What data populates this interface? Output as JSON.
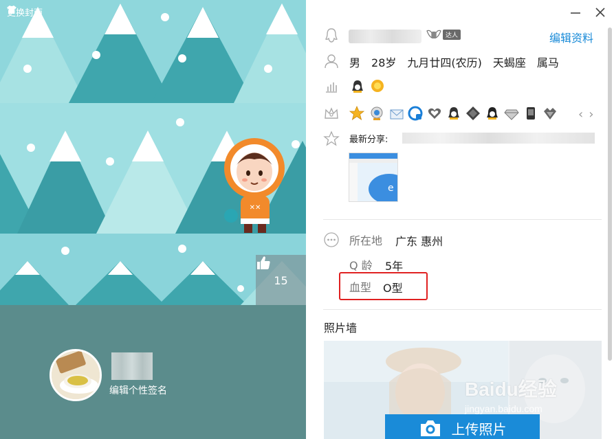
{
  "window": {
    "minimize_label": "minimize",
    "close_label": "close"
  },
  "cover": {
    "change_cover_label": "更换封面",
    "change_cover_icon": "tshirt-icon",
    "like_icon": "thumbs-up-icon",
    "like_count": "15"
  },
  "profile": {
    "signature_label": "编辑个性签名",
    "avatar_desc": "tea-cup-avatar"
  },
  "header": {
    "penguin_icon": "qq-penguin-icon",
    "daren_tag": "达人",
    "edit_profile_label": "编辑资料"
  },
  "basic_info": {
    "icon": "person-icon",
    "items": [
      "男",
      "28岁",
      "九月廿四(农历)",
      "天蝎座",
      "属马"
    ]
  },
  "level_row": {
    "icon": "level-chart-icon"
  },
  "badges_row": {
    "icon": "crown-icon",
    "prev_label": "‹",
    "next_label": "›"
  },
  "share": {
    "icon": "star-icon",
    "label": "最新分享:"
  },
  "details": {
    "icon": "more-dots-icon",
    "location_label": "所在地",
    "location_value": "广东 惠州",
    "qage_label": "Q 龄",
    "qage_value": "5年",
    "blood_label": "血型",
    "blood_value": "O型"
  },
  "photo_wall": {
    "title": "照片墙",
    "upload_label": "上传照片",
    "upload_icon": "camera-icon"
  },
  "watermark": {
    "brand": "Baidu经验",
    "url": "jingyan.baidu.com"
  },
  "colors": {
    "cover_bg": "#a6dee0",
    "profile_bar": "#5b8c8c",
    "link_blue": "#1a8bd8",
    "highlight_red": "#e02020"
  }
}
